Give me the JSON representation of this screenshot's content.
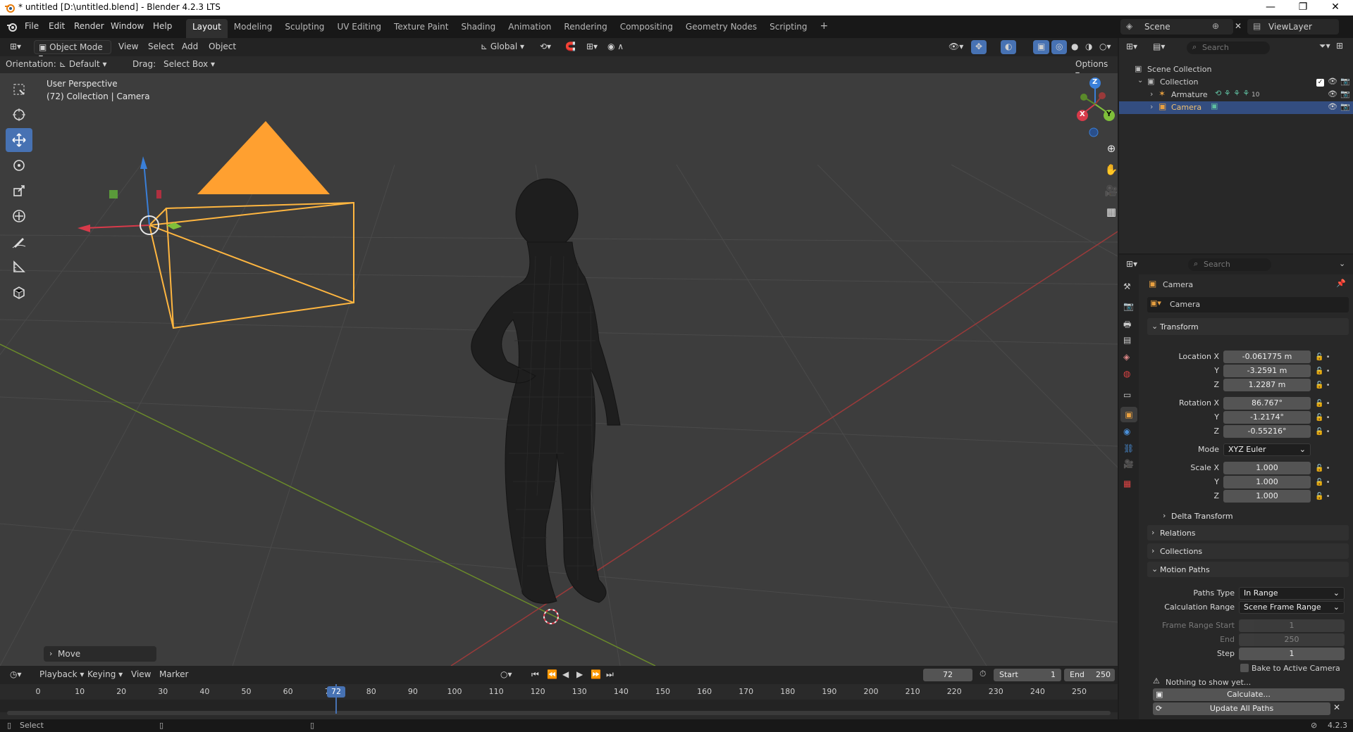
{
  "titlebar": {
    "title": "* untitled [D:\\untitled.blend] - Blender 4.2.3 LTS",
    "min": "—",
    "max": "❐",
    "close": "✕"
  },
  "menu": {
    "file": "File",
    "edit": "Edit",
    "render": "Render",
    "window": "Window",
    "help": "Help"
  },
  "workspaces": [
    "Layout",
    "Modeling",
    "Sculpting",
    "UV Editing",
    "Texture Paint",
    "Shading",
    "Animation",
    "Rendering",
    "Compositing",
    "Geometry Nodes",
    "Scripting"
  ],
  "workspace_add": "+",
  "scene": {
    "label": "Scene",
    "viewlayer": "ViewLayer"
  },
  "viewport_header": {
    "mode": "Object Mode",
    "view": "View",
    "select": "Select",
    "add": "Add",
    "object": "Object",
    "transform_orientation": "Global"
  },
  "tool_settings": {
    "orientation_label": "Orientation:",
    "orientation_value": "Default",
    "drag_label": "Drag:",
    "drag_value": "Select Box",
    "options": "Options"
  },
  "viewport": {
    "perspective": "User Perspective",
    "context": "(72) Collection | Camera",
    "last_op": "Move"
  },
  "gizmo": {
    "z": "Z",
    "x": "X",
    "y": "Y"
  },
  "outliner": {
    "search_placeholder": "Search",
    "scene_collection": "Scene Collection",
    "collection": "Collection",
    "items": [
      {
        "name": "Armature"
      },
      {
        "name": "Camera"
      }
    ],
    "armature_count": "10"
  },
  "properties": {
    "search_placeholder": "Search",
    "object_name": "Camera",
    "datablock_name": "Camera",
    "transform": {
      "title": "Transform",
      "location_label": "Location X",
      "location": [
        "-0.061775 m",
        "-3.2591 m",
        "1.2287 m"
      ],
      "rotation_label": "Rotation X",
      "rotation": [
        "86.767°",
        "-1.2174°",
        "-0.55216°"
      ],
      "mode_label": "Mode",
      "mode": "XYZ Euler",
      "scale_label": "Scale X",
      "scale": [
        "1.000",
        "1.000",
        "1.000"
      ],
      "y_label": "Y",
      "z_label": "Z"
    },
    "delta_transform": "Delta Transform",
    "relations": "Relations",
    "collections": "Collections",
    "motion_paths": {
      "title": "Motion Paths",
      "paths_type_label": "Paths Type",
      "paths_type": "In Range",
      "calc_range_label": "Calculation Range",
      "calc_range": "Scene Frame Range",
      "frame_start_label": "Frame Range Start",
      "frame_start": "1",
      "end_label": "End",
      "end": "250",
      "step_label": "Step",
      "step": "1",
      "bake": "Bake to Active Camera",
      "nothing": "Nothing to show yet...",
      "calculate": "Calculate...",
      "update": "Update All Paths"
    }
  },
  "timeline": {
    "playback": "Playback",
    "keying": "Keying",
    "view": "View",
    "marker": "Marker",
    "current_frame": "72",
    "start_label": "Start",
    "start": "1",
    "end_label": "End",
    "end": "250",
    "ticks": [
      "0",
      "10",
      "20",
      "30",
      "40",
      "50",
      "60",
      "70",
      "80",
      "90",
      "100",
      "110",
      "120",
      "130",
      "140",
      "150",
      "160",
      "170",
      "180",
      "190",
      "200",
      "210",
      "220",
      "230",
      "240",
      "250"
    ],
    "cursor_label": "72"
  },
  "status": {
    "select": "Select",
    "version": "4.2.3"
  }
}
